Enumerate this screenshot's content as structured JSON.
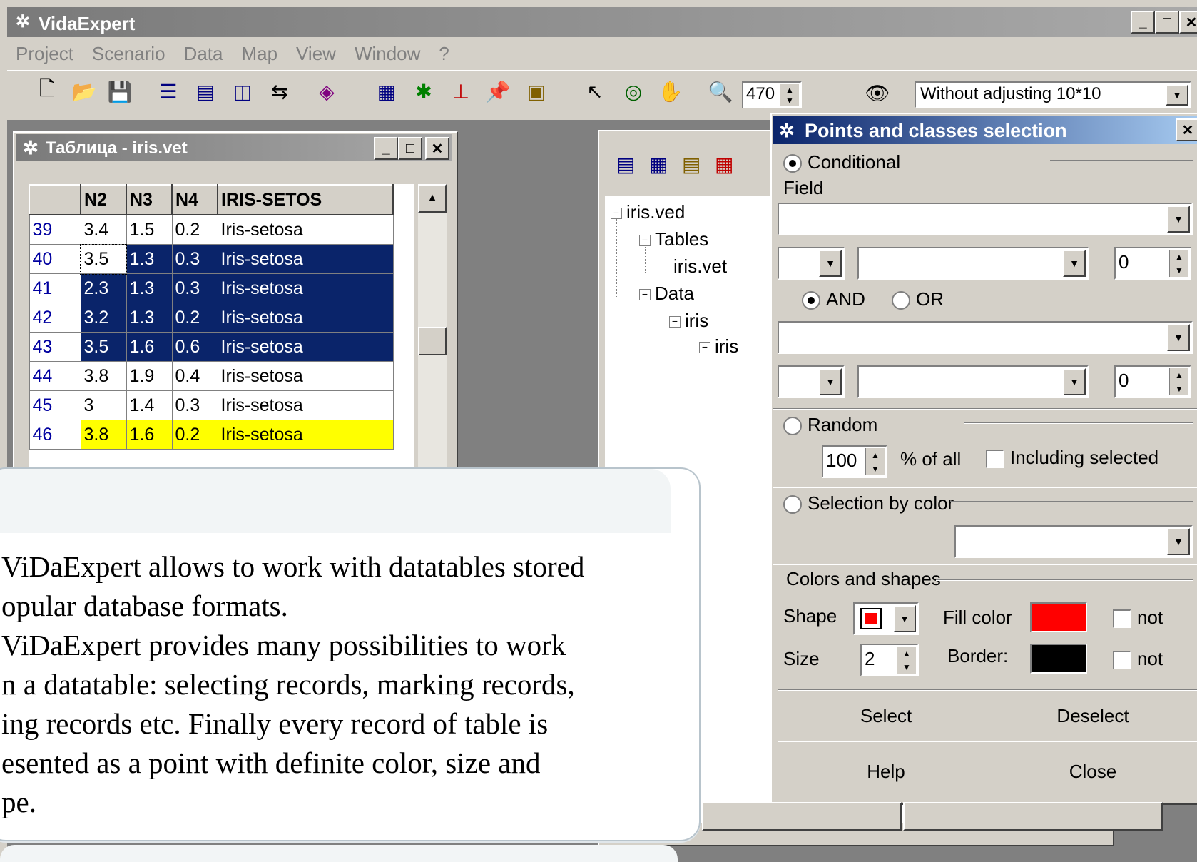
{
  "app": {
    "title": "VidaExpert",
    "menu": [
      "Project",
      "Scenario",
      "Data",
      "Map",
      "View",
      "Window",
      "?"
    ]
  },
  "toolbar": {
    "zoom_value": "470",
    "projection_value": "Without adjusting 10*10"
  },
  "table_window": {
    "title": "Таблица - iris.vet",
    "columns": [
      "N2",
      "N3",
      "N4",
      "IRIS-SETOS"
    ],
    "rows": [
      {
        "id": "39",
        "n2": "3.4",
        "n3": "1.5",
        "n4": "0.2",
        "cls": "Iris-setosa",
        "state": "normal"
      },
      {
        "id": "40",
        "n2": "3.5",
        "n3": "1.3",
        "n4": "0.3",
        "cls": "Iris-setosa",
        "state": "selected"
      },
      {
        "id": "41",
        "n2": "2.3",
        "n3": "1.3",
        "n4": "0.3",
        "cls": "Iris-setosa",
        "state": "selected"
      },
      {
        "id": "42",
        "n2": "3.2",
        "n3": "1.3",
        "n4": "0.2",
        "cls": "Iris-setosa",
        "state": "selected"
      },
      {
        "id": "43",
        "n2": "3.5",
        "n3": "1.6",
        "n4": "0.6",
        "cls": "Iris-setosa",
        "state": "selected"
      },
      {
        "id": "44",
        "n2": "3.8",
        "n3": "1.9",
        "n4": "0.4",
        "cls": "Iris-setosa",
        "state": "normal"
      },
      {
        "id": "45",
        "n2": "3",
        "n3": "1.4",
        "n4": "0.3",
        "cls": "Iris-setosa",
        "state": "normal"
      },
      {
        "id": "46",
        "n2": "3.8",
        "n3": "1.6",
        "n4": "0.2",
        "cls": "Iris-setosa",
        "state": "highlighted"
      }
    ]
  },
  "tree": {
    "root": "iris.ved",
    "tables": "Tables",
    "table_file": "iris.vet",
    "data": "Data",
    "iris1": "iris",
    "iris2": "iris"
  },
  "dialog": {
    "title": "Points and classes selection",
    "conditional": "Conditional",
    "field": "Field",
    "value1": "0",
    "value2": "0",
    "and": "AND",
    "or": "OR",
    "random": "Random",
    "random_value": "100",
    "percent_of_all": "% of all",
    "including_selected": "Including selected",
    "selection_by_color": "Selection by color",
    "colors_and_shapes": "Colors and shapes",
    "shape": "Shape",
    "fill_color": "Fill color",
    "not1": "not",
    "size": "Size",
    "size_value": "2",
    "border": "Border:",
    "not2": "not",
    "select": "Select",
    "deselect": "Deselect",
    "help": "Help",
    "close": "Close",
    "fill_color_hex": "#ff0000",
    "border_color_hex": "#000000"
  },
  "caption": {
    "lines": [
      "ViDaExpert allows to work with datatables stored",
      "opular database formats.",
      "ViDaExpert provides many possibilities to work",
      "n a datatable: selecting records, marking records,",
      "ing records etc. Finally every record of table is",
      "esented as a point with definite color, size and",
      "pe."
    ]
  }
}
